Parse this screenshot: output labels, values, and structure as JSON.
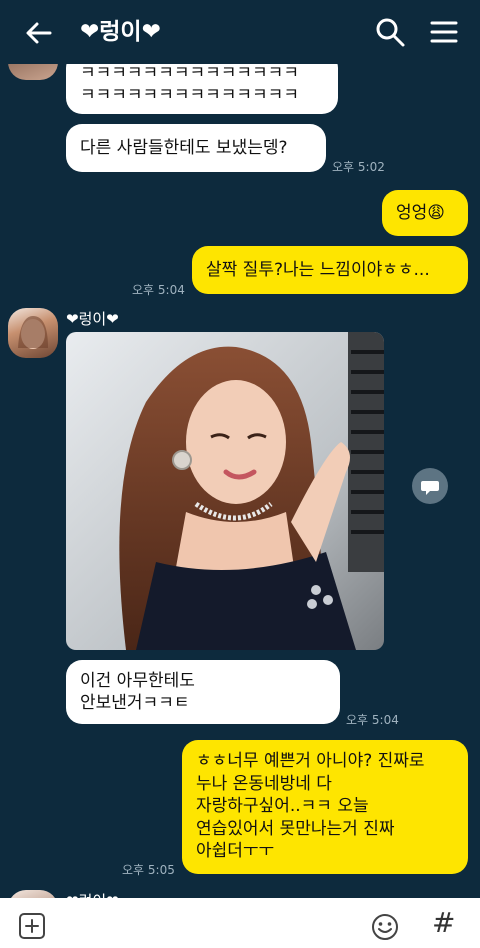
{
  "header": {
    "title": "❤렁이❤"
  },
  "messages": [
    {
      "line1": "ㅋㅋㅋㅋㅋㅋㅋㅋㅋㅋㅋㅋㅋㅋ",
      "line2": "ㅋㅋㅋㅋㅋㅋㅋㅋㅋㅋㅋㅋㅋㅋ"
    },
    {
      "text": "다른 사람들한테도 보냈는뎅?",
      "time": "오후 5:02"
    },
    {
      "text": "엉엉😩"
    },
    {
      "text": "살짝 질투?나는 느낌이야ㅎㅎ...",
      "time": "오후 5:04"
    },
    {
      "sender": "❤렁이❤"
    },
    {
      "line1": "이건 아무한테도",
      "line2": "안보낸거ㅋㅋㅌ",
      "time": "오후 5:04"
    },
    {
      "lines": [
        "ㅎㅎ너무 예쁜거 아니야? 진짜로",
        "누나 온동네방네 다",
        "자랑하구싶어..ㅋㅋ 오늘",
        "연습있어서 못만나는거 진짜",
        "아쉽더ㅜㅜ"
      ],
      "time": "오후 5:05"
    },
    {
      "sender": "❤렁이❤"
    }
  ],
  "bottom": {
    "hash_label": "#"
  },
  "icons": {
    "back": "back-arrow-icon",
    "search": "search-icon",
    "menu": "menu-icon",
    "share": "share-icon",
    "plus": "plus-icon",
    "emoji": "emoji-icon"
  },
  "colors": {
    "background": "#0d2a3d",
    "outgoing": "#fee500",
    "incoming": "#ffffff"
  }
}
